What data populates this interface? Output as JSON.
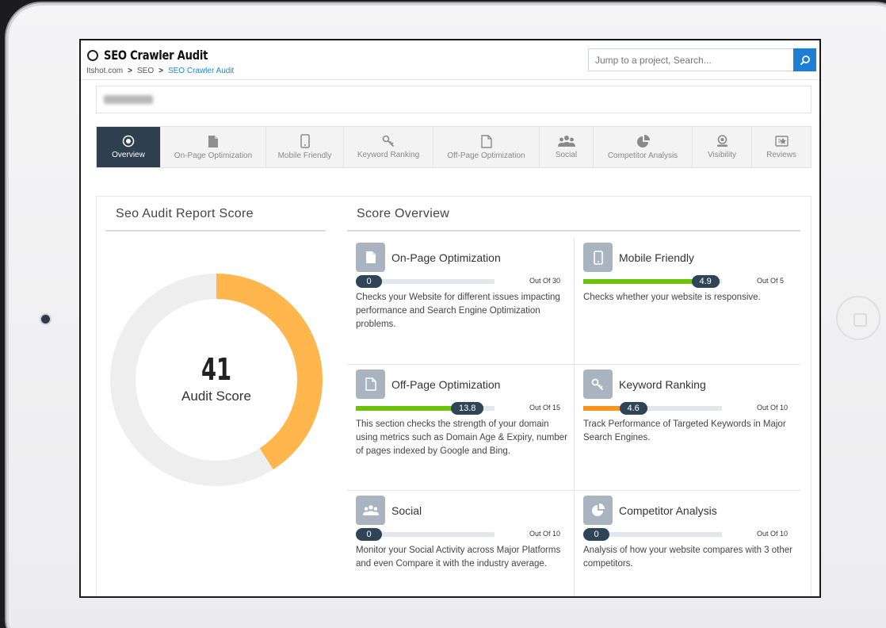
{
  "app": {
    "title": "SEO Crawler Audit",
    "breadcrumb": [
      "Itshot.com",
      "SEO",
      "SEO Crawler Audit"
    ],
    "breadcrumb_sep": ">"
  },
  "search": {
    "placeholder": "Jump to a project, Search..."
  },
  "domain": {
    "value": "Itshot.com"
  },
  "tabs": [
    {
      "label": "Overview",
      "icon": "target-icon",
      "active": true
    },
    {
      "label": "On-Page Optimization",
      "icon": "page-icon",
      "active": false
    },
    {
      "label": "Mobile Friendly",
      "icon": "mobile-icon",
      "active": false
    },
    {
      "label": "Keyword Ranking",
      "icon": "key-icon",
      "active": false
    },
    {
      "label": "Off-Page Optimization",
      "icon": "file-icon",
      "active": false
    },
    {
      "label": "Social",
      "icon": "users-icon",
      "active": false
    },
    {
      "label": "Competitor Analysis",
      "icon": "pie-icon",
      "active": false
    },
    {
      "label": "Visibility",
      "icon": "eye-icon",
      "active": false
    },
    {
      "label": "Reviews",
      "icon": "review-icon",
      "active": false
    }
  ],
  "report": {
    "title": "Seo Audit Report Score",
    "score": "41",
    "score_label": "Audit Score",
    "score_value": 41,
    "score_max": 100,
    "colors": {
      "arc": "#ffb74d",
      "track": "#eeeeee"
    }
  },
  "overview": {
    "title": "Score Overview",
    "cards": [
      {
        "name": "On-Page Optimization",
        "icon": "page-icon",
        "score": "0",
        "max": "Out Of 30",
        "value": 0,
        "max_value": 30,
        "color": "#6cc20b",
        "desc": "Checks your Website for different issues impacting performance and Search Engine Optimization problems."
      },
      {
        "name": "Mobile Friendly",
        "icon": "mobile-icon",
        "score": "4.9",
        "max": "Out Of 5",
        "value": 4.9,
        "max_value": 5,
        "color": "#6cc20b",
        "desc": "Checks whether your website is responsive."
      },
      {
        "name": "Off-Page Optimization",
        "icon": "file-icon",
        "score": "13.8",
        "max": "Out Of 15",
        "value": 13.8,
        "max_value": 15,
        "color": "#6cc20b",
        "desc": "This section checks the strength of your domain using metrics such as Domain Age & Expiry, number of pages indexed by Google and Bing."
      },
      {
        "name": "Keyword Ranking",
        "icon": "key-icon",
        "score": "4.6",
        "max": "Out Of 10",
        "value": 4.6,
        "max_value": 10,
        "color": "#f7941d",
        "desc": "Track Performance of Targeted Keywords in Major Search Engines."
      },
      {
        "name": "Social",
        "icon": "users-icon",
        "score": "0",
        "max": "Out Of 10",
        "value": 0,
        "max_value": 10,
        "color": "#6cc20b",
        "desc": "Monitor your Social Activity across Major Platforms and even Compare it with the industry average."
      },
      {
        "name": "Competitor Analysis",
        "icon": "pie-icon",
        "score": "0",
        "max": "Out Of 10",
        "value": 0,
        "max_value": 10,
        "color": "#6cc20b",
        "desc": "Analysis of how your website compares with 3 other competitors."
      }
    ]
  }
}
